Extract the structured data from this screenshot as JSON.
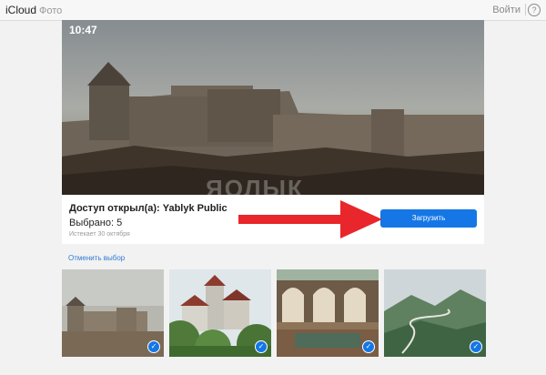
{
  "header": {
    "brand": "iCloud",
    "section": "Фото",
    "login": "Войти",
    "help": "?"
  },
  "hero": {
    "time": "10:47"
  },
  "panel": {
    "shared_by": "Доступ открыл(а): Yablyk Public",
    "selected": "Выбрано: 5",
    "expires": "Истекает 30 октября",
    "upload_label": "Загрузить",
    "watermark": "ЯОЛЫК"
  },
  "deselect_label": "Отменить выбор",
  "thumbnails": [
    {
      "subject": "fortress",
      "selected": true
    },
    {
      "subject": "castle",
      "selected": true
    },
    {
      "subject": "cloister",
      "selected": true
    },
    {
      "subject": "mountain-road",
      "selected": true
    }
  ],
  "colors": {
    "accent": "#1577e6",
    "arrow": "#e8262b"
  },
  "icons": {
    "check": "checkmark-icon",
    "arrow": "red-arrow-annotation"
  }
}
